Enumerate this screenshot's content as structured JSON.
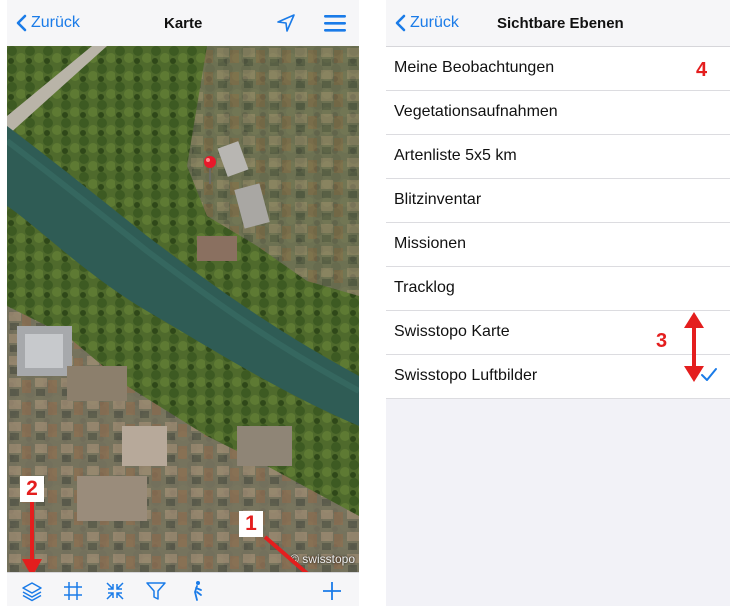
{
  "left": {
    "back_label": "Zurück",
    "title": "Karte",
    "copyright": "© swisstopo",
    "toolbar_icons": [
      "layers-icon",
      "grid-icon",
      "collapse-arrows-icon",
      "filter-icon",
      "walking-person-icon",
      "plus-icon"
    ],
    "markers": {
      "one": "1",
      "two": "2"
    }
  },
  "right": {
    "back_label": "Zurück",
    "title": "Sichtbare Ebenen",
    "layers": [
      {
        "label": "Meine Beobachtungen",
        "checked": false
      },
      {
        "label": "Vegetationsaufnahmen",
        "checked": false
      },
      {
        "label": "Artenliste 5x5 km",
        "checked": false
      },
      {
        "label": "Blitzinventar",
        "checked": false
      },
      {
        "label": "Missionen",
        "checked": false
      },
      {
        "label": "Tracklog",
        "checked": false
      },
      {
        "label": "Swisstopo Karte",
        "checked": false
      },
      {
        "label": "Swisstopo Luftbilder",
        "checked": true
      }
    ],
    "markers": {
      "three": "3",
      "four": "4"
    }
  },
  "colors": {
    "accent": "#1a7be8",
    "annotation": "#e41e1e",
    "river": "#2f5c55"
  }
}
